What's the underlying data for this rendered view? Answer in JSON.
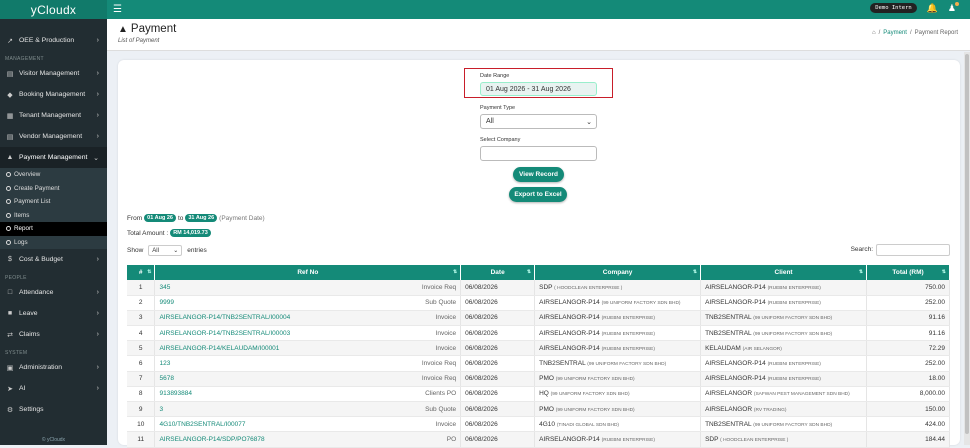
{
  "app": {
    "logo": "yCloudx",
    "user_badge": "Demo Intern"
  },
  "sidebar": {
    "top_items": [
      {
        "label": "OEE & Production",
        "icon": "chart-line-icon"
      }
    ],
    "management_header": "MANAGEMENT",
    "management_items": [
      {
        "label": "Visitor Management",
        "icon": "id-card-icon"
      },
      {
        "label": "Booking Management",
        "icon": "tag-icon"
      },
      {
        "label": "Tenant Management",
        "icon": "building-icon"
      },
      {
        "label": "Vendor Management",
        "icon": "vendor-card-icon"
      },
      {
        "label": "Payment Management",
        "icon": "cart-icon"
      }
    ],
    "payment_sub": [
      "Overview",
      "Create Payment",
      "Payment List",
      "Items",
      "Report",
      "Logs"
    ],
    "budget_item": {
      "label": "Cost & Budget",
      "icon": "dollar-icon"
    },
    "people_header": "PEOPLE",
    "people_items": [
      {
        "label": "Attendance",
        "icon": "calendar-icon"
      },
      {
        "label": "Leave",
        "icon": "leave-icon"
      },
      {
        "label": "Claims",
        "icon": "exchange-icon"
      }
    ],
    "system_header": "SYSTEM",
    "system_items": [
      {
        "label": "Administration",
        "icon": "admin-icon"
      },
      {
        "label": "AI",
        "icon": "rocket-icon"
      },
      {
        "label": "Settings",
        "icon": "gear-icon"
      }
    ],
    "footer": "© yCloudx"
  },
  "header": {
    "title": "Payment",
    "subtitle": "List of Payment",
    "breadcrumb": [
      "Payment",
      "Payment Report"
    ]
  },
  "filters": {
    "date_range_label": "Date Range",
    "date_range_value": "01 Aug 2026 - 31 Aug 2026",
    "payment_type_label": "Payment Type",
    "payment_type_value": "All",
    "company_label": "Select Company",
    "company_value": "",
    "view_button": "View Record",
    "export_button": "Export to Excel"
  },
  "summary": {
    "from_label": "From",
    "from_date": "01 Aug 26",
    "to_label": "to",
    "to_date": "31 Aug 26",
    "date_note": "(Payment Date)",
    "total_label": "Total Amount :",
    "total_value": "RM 14,019.73"
  },
  "table_controls": {
    "show_label": "Show",
    "show_value": "All",
    "entries_label": "entries",
    "search_label": "Search:"
  },
  "table": {
    "columns": [
      "#",
      "Ref No",
      "Date",
      "Company",
      "Client",
      "Total (RM)"
    ],
    "rows": [
      {
        "n": "1",
        "ref": "345",
        "type": "Invoice Req",
        "date": "06/08/2026",
        "co": "SDP",
        "co_sub": "( HOODCLEAN ENTERPRISE )",
        "cl": "AIRSELANGOR-P14",
        "cl_sub": "(RUEBNI ENTERPRISE)",
        "total": "750.00"
      },
      {
        "n": "2",
        "ref": "9999",
        "type": "Sub Quote",
        "date": "06/08/2026",
        "co": "AIRSELANGOR-P14",
        "co_sub": "(99 UNIFORM FACTORY SDN BHD)",
        "cl": "AIRSELANGOR-P14",
        "cl_sub": "(RUEBNI ENTERPRISE)",
        "total": "252.00"
      },
      {
        "n": "3",
        "ref": "AIRSELANGOR-P14/TNB2SENTRAL/I00004",
        "type": "Invoice",
        "date": "06/08/2026",
        "co": "AIRSELANGOR-P14",
        "co_sub": "(RUEBNI ENTERPRISE)",
        "cl": "TNB2SENTRAL",
        "cl_sub": "(99 UNIFORM FACTORY SDN BHD)",
        "total": "91.16"
      },
      {
        "n": "4",
        "ref": "AIRSELANGOR-P14/TNB2SENTRAL/I00003",
        "type": "Invoice",
        "date": "06/08/2026",
        "co": "AIRSELANGOR-P14",
        "co_sub": "(RUEBNI ENTERPRISE)",
        "cl": "TNB2SENTRAL",
        "cl_sub": "(99 UNIFORM FACTORY SDN BHD)",
        "total": "91.16"
      },
      {
        "n": "5",
        "ref": "AIRSELANGOR-P14/KELAUDAM/I00001",
        "type": "Invoice",
        "date": "06/08/2026",
        "co": "AIRSELANGOR-P14",
        "co_sub": "(RUEBNI ENTERPRISE)",
        "cl": "KELAUDAM",
        "cl_sub": "(AIR SELANGOR)",
        "total": "72.29"
      },
      {
        "n": "6",
        "ref": "123",
        "type": "Invoice Req",
        "date": "06/08/2026",
        "co": "TNB2SENTRAL",
        "co_sub": "(99 UNIFORM FACTORY SDN BHD)",
        "cl": "AIRSELANGOR-P14",
        "cl_sub": "(RUEBNI ENTERPRISE)",
        "total": "252.00"
      },
      {
        "n": "7",
        "ref": "5678",
        "type": "Invoice Req",
        "date": "06/08/2026",
        "co": "PMO",
        "co_sub": "(99 UNIFORM FACTORY SDN BHD)",
        "cl": "AIRSELANGOR-P14",
        "cl_sub": "(RUEBNI ENTERPRISE)",
        "total": "18.00"
      },
      {
        "n": "8",
        "ref": "913893884",
        "type": "Clients PO",
        "date": "06/08/2026",
        "co": "HQ",
        "co_sub": "(99 UNIFORM FACTORY SDN BHD)",
        "cl": "AIRSELANGOR",
        "cl_sub": "(SAFWAN PEST MANAGEMENT SDN BHD)",
        "total": "8,000.00"
      },
      {
        "n": "9",
        "ref": "3",
        "type": "Sub Quote",
        "date": "06/08/2026",
        "co": "PMO",
        "co_sub": "(99 UNIFORM FACTORY SDN BHD)",
        "cl": "AIRSELANGOR",
        "cl_sub": "(RV TRADING)",
        "total": "150.00"
      },
      {
        "n": "10",
        "ref": "4G10/TNB2SENTRAL/I00077",
        "type": "Invoice",
        "date": "06/08/2026",
        "co": "4G10",
        "co_sub": "(TINADI GLOBAL SDN BHD)",
        "cl": "TNB2SENTRAL",
        "cl_sub": "(99 UNIFORM FACTORY SDN BHD)",
        "total": "424.00"
      },
      {
        "n": "11",
        "ref": "AIRSELANGOR-P14/SDP/PO76878",
        "type": "PO",
        "date": "06/08/2026",
        "co": "AIRSELANGOR-P14",
        "co_sub": "(RUEBNI ENTERPRISE)",
        "cl": "SDP",
        "cl_sub": "( HOODCLEAN ENTERPRISE )",
        "total": "184.44"
      }
    ]
  }
}
